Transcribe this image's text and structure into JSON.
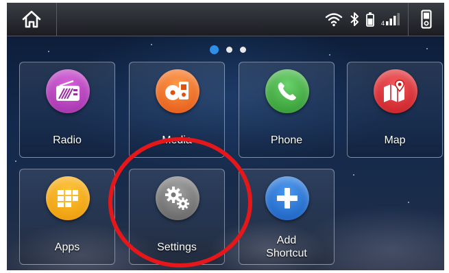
{
  "status_bar": {
    "home_icon": "home-icon",
    "wifi_icon": "wifi-icon",
    "bluetooth_icon": "bluetooth-icon",
    "battery_icon": "battery-icon",
    "signal_icon": "signal-icon",
    "phone_icon": "phone-device-icon"
  },
  "pagination": {
    "pages": 3,
    "active": 1
  },
  "tiles": [
    {
      "label": "Radio",
      "icon": "radio-icon",
      "color": "#b23bb8"
    },
    {
      "label": "Media",
      "icon": "media-icon",
      "color": "#f26a1b"
    },
    {
      "label": "Phone",
      "icon": "phone-icon",
      "color": "#3aa63a"
    },
    {
      "label": "Map",
      "icon": "map-icon",
      "color": "#d9262c"
    },
    {
      "label": "Apps",
      "icon": "apps-icon",
      "color": "#f7a700"
    },
    {
      "label": "Settings",
      "icon": "gear-icon",
      "color": "#6e6e6e"
    },
    {
      "label_line1": "Add",
      "label_line2": "Shortcut",
      "icon": "plus-icon",
      "color": "#1f6fd6"
    }
  ],
  "annotation": {
    "color": "#e4171b",
    "target": "Settings"
  }
}
